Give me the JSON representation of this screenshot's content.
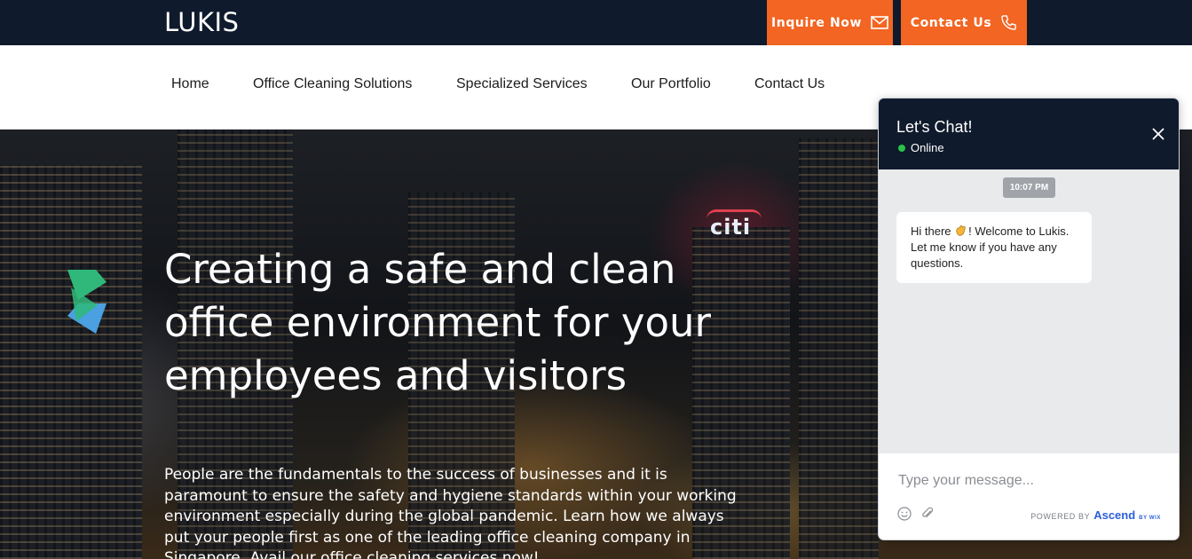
{
  "brand": {
    "logo": "LUKIS",
    "accent": "#f26522",
    "navy": "#0f1a2c"
  },
  "topbar": {
    "inquire_label": "Inquire Now",
    "contact_label": "Contact Us"
  },
  "nav": {
    "items": [
      {
        "label": "Home"
      },
      {
        "label": "Office Cleaning Solutions"
      },
      {
        "label": "Specialized Services"
      },
      {
        "label": "Our Portfolio"
      },
      {
        "label": "Contact Us"
      }
    ]
  },
  "hero": {
    "title": "Creating a safe and clean office environment for your employees and visitors",
    "body": "People are the fundamentals to the success of businesses and it is paramount to ensure the safety and hygiene standards within your working environment especially during the global pandemic. Learn how we always put your people first as one of the leading office cleaning company in Singapore. Avail our office cleaning services now!",
    "background_signage": "citi"
  },
  "chat": {
    "title": "Let's Chat!",
    "status": "Online",
    "status_color": "#2bc24a",
    "timestamp": "10:07 PM",
    "message_before": "Hi there ",
    "message_emoji": "waving-hand-icon",
    "message_after": "! Welcome to Lukis. Let me know if you have any questions.",
    "input_placeholder": "Type your message...",
    "powered_by": "POWERED BY",
    "powered_brand": "Ascend",
    "powered_suffix": "BY WIX"
  }
}
